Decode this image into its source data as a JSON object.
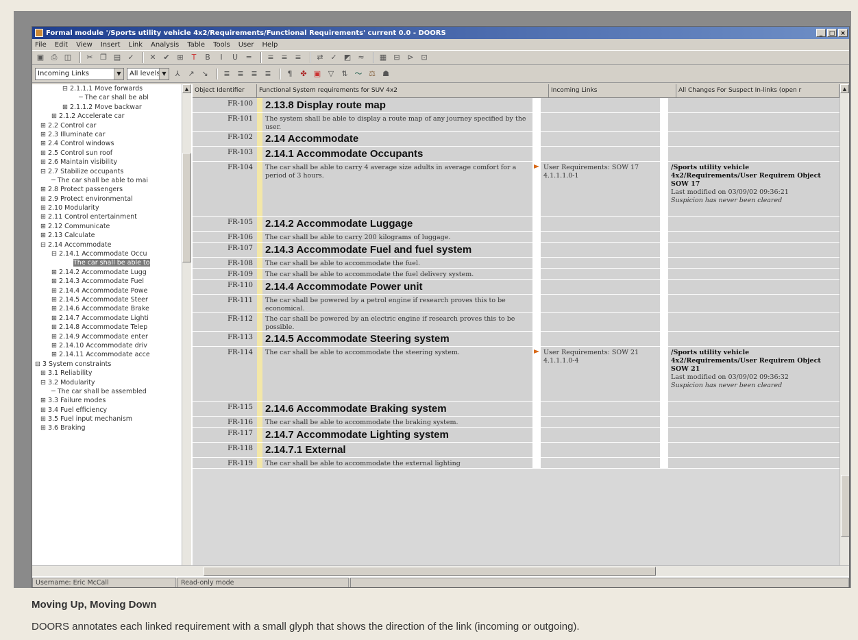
{
  "window": {
    "title": "Formal module '/Sports utility vehicle 4x2/Requirements/Functional Requirements' current 0.0 - DOORS",
    "controls": [
      "_",
      "□",
      "×"
    ]
  },
  "menu": [
    "File",
    "Edit",
    "View",
    "Insert",
    "Link",
    "Analysis",
    "Table",
    "Tools",
    "User",
    "Help"
  ],
  "toolbar2": {
    "view_select": "Incoming Links",
    "level_select": "All levels"
  },
  "tree": [
    {
      "label": "⊟ 2.1.1.1 Move forwards",
      "indent": 5
    },
    {
      "label": "─ The car shall be abl",
      "indent": 8
    },
    {
      "label": "⊞ 2.1.1.2 Move backwar",
      "indent": 5
    },
    {
      "label": "⊞ 2.1.2 Accelerate car",
      "indent": 3
    },
    {
      "label": "⊞ 2.2 Control car",
      "indent": 1
    },
    {
      "label": "⊞ 2.3 Illuminate car",
      "indent": 1
    },
    {
      "label": "⊞ 2.4 Control windows",
      "indent": 1
    },
    {
      "label": "⊞ 2.5 Control sun roof",
      "indent": 1
    },
    {
      "label": "⊞ 2.6 Maintain visibility",
      "indent": 1
    },
    {
      "label": "⊟ 2.7 Stabilize occupants",
      "indent": 1
    },
    {
      "label": "─ The car shall be able to mai",
      "indent": 3
    },
    {
      "label": "⊞ 2.8 Protect passengers",
      "indent": 1
    },
    {
      "label": "⊞ 2.9 Protect environmental",
      "indent": 1
    },
    {
      "label": "⊞ 2.10 Modularity",
      "indent": 1
    },
    {
      "label": "⊞ 2.11 Control entertainment",
      "indent": 1
    },
    {
      "label": "⊞ 2.12 Communicate",
      "indent": 1
    },
    {
      "label": "⊞ 2.13 Calculate",
      "indent": 1
    },
    {
      "label": "⊟ 2.14 Accommodate",
      "indent": 1
    },
    {
      "label": "⊟ 2.14.1 Accommodate Occu",
      "indent": 3
    },
    {
      "label": "The car shall be able to",
      "indent": 7,
      "selected": true
    },
    {
      "label": "⊞ 2.14.2 Accommodate Lugg",
      "indent": 3
    },
    {
      "label": "⊞ 2.14.3 Accommodate Fuel",
      "indent": 3
    },
    {
      "label": "⊞ 2.14.4 Accommodate Powe",
      "indent": 3
    },
    {
      "label": "⊞ 2.14.5 Accommodate Steer",
      "indent": 3
    },
    {
      "label": "⊞ 2.14.6 Accommodate Brake",
      "indent": 3
    },
    {
      "label": "⊞ 2.14.7 Accommodate Lighti",
      "indent": 3
    },
    {
      "label": "⊞ 2.14.8 Accommodate Telep",
      "indent": 3
    },
    {
      "label": "⊞ 2.14.9 Accommodate enter",
      "indent": 3
    },
    {
      "label": "⊞ 2.14.10 Accommodate driv",
      "indent": 3
    },
    {
      "label": "⊞ 2.14.11 Accommodate acce",
      "indent": 3
    },
    {
      "label": "⊟ 3 System constraints",
      "indent": 0
    },
    {
      "label": "⊞ 3.1 Reliability",
      "indent": 1
    },
    {
      "label": "⊟ 3.2 Modularity",
      "indent": 1
    },
    {
      "label": "─ The car shall be assembled",
      "indent": 3
    },
    {
      "label": "⊞ 3.3 Failure modes",
      "indent": 1
    },
    {
      "label": "⊞ 3.4 Fuel efficiency",
      "indent": 1
    },
    {
      "label": "⊞ 3.5 Fuel input mechanism",
      "indent": 1
    },
    {
      "label": "⊞ 3.6 Braking",
      "indent": 1
    }
  ],
  "columns": {
    "id": "Object Identifier",
    "text": "Functional System requirements for SUV 4x2",
    "incoming": "Incoming Links",
    "changes": "All Changes For Suspect In-links (open r"
  },
  "rows": [
    {
      "id": "FR-100",
      "heading": true,
      "text": "2.13.8 Display route map"
    },
    {
      "id": "FR-101",
      "text": "The system shall be able to display a route map of any journey specified by the user."
    },
    {
      "id": "FR-102",
      "heading": true,
      "text": "2.14 Accommodate"
    },
    {
      "id": "FR-103",
      "heading": true,
      "text": "2.14.1 Accommodate Occupants"
    },
    {
      "id": "FR-104",
      "text": "The car shall be able to carry 4 average size adults in average comfort for a period of 3 hours.",
      "glyph": "incoming-link-glyph",
      "incoming": "User Requirements: SOW 17 4.1.1.1.0-1",
      "changes": {
        "object": "/Sports utility vehicle 4x2/Requirements/User Requirem Object SOW 17",
        "modified": "Last modified on 03/09/02 09:36:21",
        "note": "Suspicion has never been cleared"
      },
      "tall": true
    },
    {
      "id": "FR-105",
      "heading": true,
      "text": "2.14.2 Accommodate Luggage"
    },
    {
      "id": "FR-106",
      "text": "The car shall be able to carry 200 kilograms of luggage."
    },
    {
      "id": "FR-107",
      "heading": true,
      "text": "2.14.3 Accommodate Fuel and fuel system"
    },
    {
      "id": "FR-108",
      "text": "The car shall be able to accommodate the fuel."
    },
    {
      "id": "FR-109",
      "text": "The car shall be able to accommodate the fuel delivery system."
    },
    {
      "id": "FR-110",
      "heading": true,
      "text": "2.14.4 Accommodate Power unit"
    },
    {
      "id": "FR-111",
      "text": "The car shall be powered by a petrol engine if research proves this to be economical."
    },
    {
      "id": "FR-112",
      "text": "The car shall be powered by an electric engine if research proves this to be possible."
    },
    {
      "id": "FR-113",
      "heading": true,
      "text": "2.14.5 Accommodate Steering system"
    },
    {
      "id": "FR-114",
      "text": "The car shall be able to accommodate the steering system.",
      "glyph": "incoming-link-glyph",
      "incoming": "User Requirements: SOW 21 4.1.1.1.0-4",
      "changes": {
        "object": "/Sports utility vehicle 4x2/Requirements/User Requirem Object SOW 21",
        "modified": "Last modified on 03/09/02 09:36:32",
        "note": "Suspicion has never been cleared"
      },
      "tall": true
    },
    {
      "id": "FR-115",
      "heading": true,
      "text": "2.14.6 Accommodate Braking system"
    },
    {
      "id": "FR-116",
      "text": "The car shall be able to accommodate the braking system."
    },
    {
      "id": "FR-117",
      "heading": true,
      "text": "2.14.7 Accommodate Lighting system"
    },
    {
      "id": "FR-118",
      "heading": true,
      "text": "2.14.7.1 External"
    },
    {
      "id": "FR-119",
      "text": "The car shall be able to accommodate the external lighting"
    }
  ],
  "status": {
    "user": "Username: Eric McCall",
    "mode": "Read-only mode"
  },
  "caption": {
    "title": "Moving Up, Moving Down",
    "text": "DOORS annotates each linked requirement with a small glyph that shows the direction of the link (incoming or outgoing)."
  },
  "colors": {
    "titlebar": "#1f3f8f",
    "strip": "#f3e7a8",
    "glyph": "#d86a1a"
  }
}
